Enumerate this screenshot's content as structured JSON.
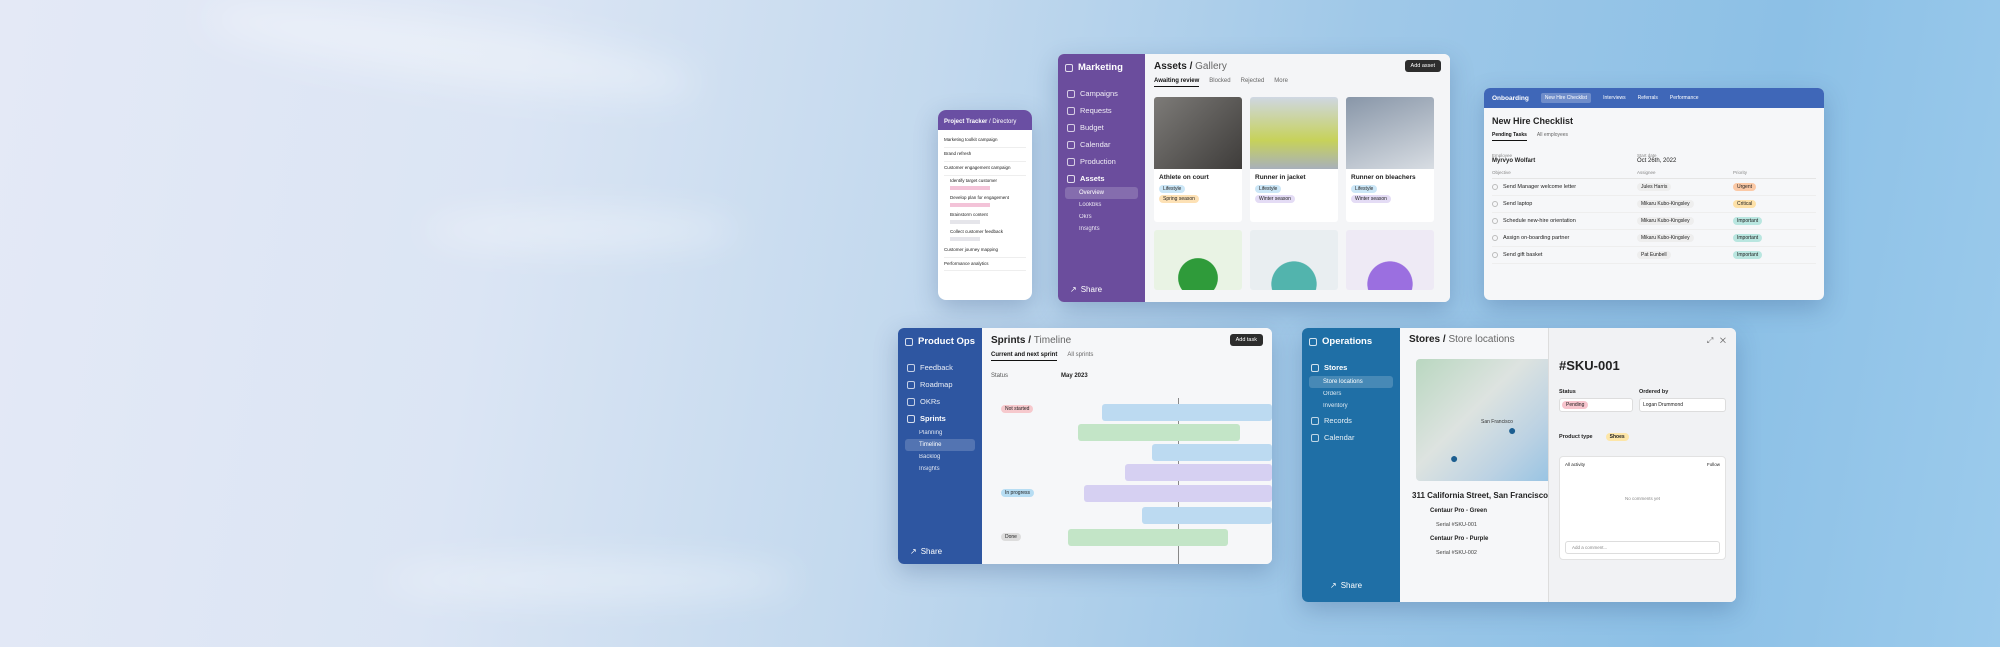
{
  "phone": {
    "title": "Project Tracker",
    "crumb": "Directory",
    "items": [
      "Marketing toolkit campaign",
      "Brand refresh",
      "Customer engagement campaign",
      "Identify target customer",
      "Develop plan for engagement",
      "Brainstorm content",
      "Collect customer feedback",
      "Customer journey mapping",
      "Performance analytics"
    ]
  },
  "marketing": {
    "workspace": "Marketing",
    "nav": [
      "Campaigns",
      "Requests",
      "Budget",
      "Calendar",
      "Production",
      "Assets"
    ],
    "sub": [
      "Overview",
      "Lookbks",
      "Okrs",
      "Insights"
    ],
    "share": "Share",
    "title": "Assets",
    "view": "Gallery",
    "add": "Add asset",
    "tabs": [
      "Awaiting review",
      "Blocked",
      "Rejected",
      "More"
    ],
    "tiles": [
      {
        "name": "Athlete on court",
        "tag1": "Lifestyle",
        "tag2": "Spring season"
      },
      {
        "name": "Runner in jacket",
        "tag1": "Lifestyle",
        "tag2": "Winter season"
      },
      {
        "name": "Runner on bleachers",
        "tag1": "Lifestyle",
        "tag2": "Winter season"
      }
    ]
  },
  "onboarding": {
    "workspace": "Onboarding",
    "tabs": [
      "New Hire Checklist",
      "Interviews",
      "Referrals",
      "Performance"
    ],
    "title": "New Hire Checklist",
    "sub": [
      "Pending Tasks",
      "All employees"
    ],
    "emp_label": "Employee",
    "emp": "Myrvyo Wolfart",
    "start_label": "Start date",
    "start": "Oct 26th, 2022",
    "cols": [
      "Objective",
      "Assignee",
      "Priority"
    ],
    "rows": [
      {
        "task": "Send Manager welcome letter",
        "who": "Jules Harris",
        "pri": "Urgent"
      },
      {
        "task": "Send laptop",
        "who": "Mikaru Kubo-Kingsley",
        "pri": "Critical"
      },
      {
        "task": "Schedule new-hire orientation",
        "who": "Mikaru Kubo-Kingsley",
        "pri": "Important"
      },
      {
        "task": "Assign on-boarding partner",
        "who": "Mikaru Kubo-Kingsley",
        "pri": "Important"
      },
      {
        "task": "Send gift basket",
        "who": "Pat Eunbell",
        "pri": "Important"
      }
    ]
  },
  "product": {
    "workspace": "Product Ops",
    "nav": [
      "Feedback",
      "Roadmap",
      "OKRs",
      "Sprints"
    ],
    "sub": [
      "Planning",
      "Timeline",
      "Backlog",
      "Insights"
    ],
    "share": "Share",
    "title": "Sprints",
    "view": "Timeline",
    "add": "Add task",
    "tabs": [
      "Current and next sprint",
      "All sprints"
    ],
    "status": "Status",
    "month": "May 2023",
    "groups": [
      "Not started",
      "In progress",
      "Done"
    ]
  },
  "ops": {
    "workspace": "Operations",
    "nav": [
      "Stores",
      "Records",
      "Calendar"
    ],
    "sub": [
      "Store locations",
      "Orders",
      "Inventory"
    ],
    "share": "Share",
    "title": "Stores",
    "view": "Store locations",
    "map_city": "San Francisco",
    "address": "311 California Street, San Francisco",
    "p1": "Centaur Pro - Green",
    "s1": "Serial #SKU-001",
    "p2": "Centaur Pro - Purple",
    "s2": "Serial #SKU-002",
    "detail": {
      "id": "#SKU-001",
      "status_label": "Status",
      "status": "Pending",
      "ordered_label": "Ordered by",
      "ordered": "Logan Drummond",
      "type_label": "Product type",
      "type": "Shoes",
      "activity": "All activity",
      "follow": "Follow",
      "empty": "No comments yet",
      "comment_ph": "Add a comment..."
    }
  }
}
